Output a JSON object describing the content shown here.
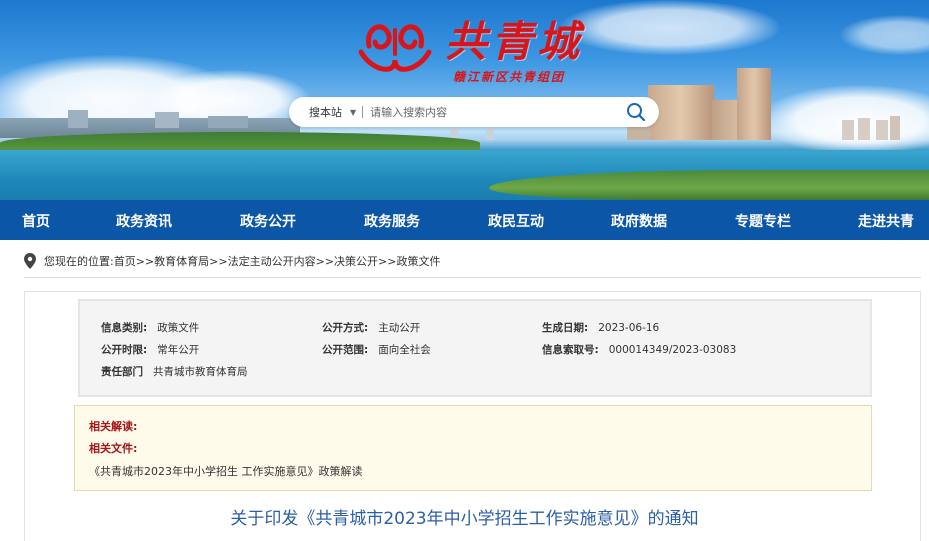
{
  "header": {
    "logo_title": "共青城",
    "logo_subtitle": "赣江新区共青组团",
    "search": {
      "scope_label": "搜本站",
      "placeholder": "请输入搜索内容"
    }
  },
  "nav": {
    "items": [
      {
        "label": "首页"
      },
      {
        "label": "政务资讯"
      },
      {
        "label": "政务公开"
      },
      {
        "label": "政务服务"
      },
      {
        "label": "政民互动"
      },
      {
        "label": "政府数据"
      },
      {
        "label": "专题专栏"
      },
      {
        "label": "走进共青"
      }
    ]
  },
  "breadcrumb": {
    "prefix": "您现在的位置:",
    "items": [
      "首页",
      "教育体育局",
      "法定主动公开内容",
      "决策公开",
      "政策文件"
    ],
    "separator": ">>"
  },
  "meta": {
    "info_type": {
      "label": "信息类别:",
      "value": "政策文件"
    },
    "open_method": {
      "label": "公开方式:",
      "value": "主动公开"
    },
    "gen_date": {
      "label": "生成日期:",
      "value": "2023-06-16"
    },
    "open_period": {
      "label": "公开时限:",
      "value": "常年公开"
    },
    "open_scope": {
      "label": "公开范围:",
      "value": "面向全社会"
    },
    "index_no": {
      "label": "信息索取号:",
      "value": "000014349/2023-03083"
    },
    "department": {
      "label": "责任部门",
      "value": "共青城市教育体育局"
    }
  },
  "related": {
    "interpretation_label": "相关解读:",
    "files_label": "相关文件:",
    "link": "《共青城市2023年中小学招生 工作实施意见》政策解读"
  },
  "document": {
    "title": "关于印发《共青城市2023年中小学招生工作实施意见》的通知"
  },
  "colors": {
    "nav_bg": "#0b56a6",
    "logo_red": "#d8161a",
    "label_red": "#a8141a",
    "title_blue": "#2b5fa8"
  }
}
